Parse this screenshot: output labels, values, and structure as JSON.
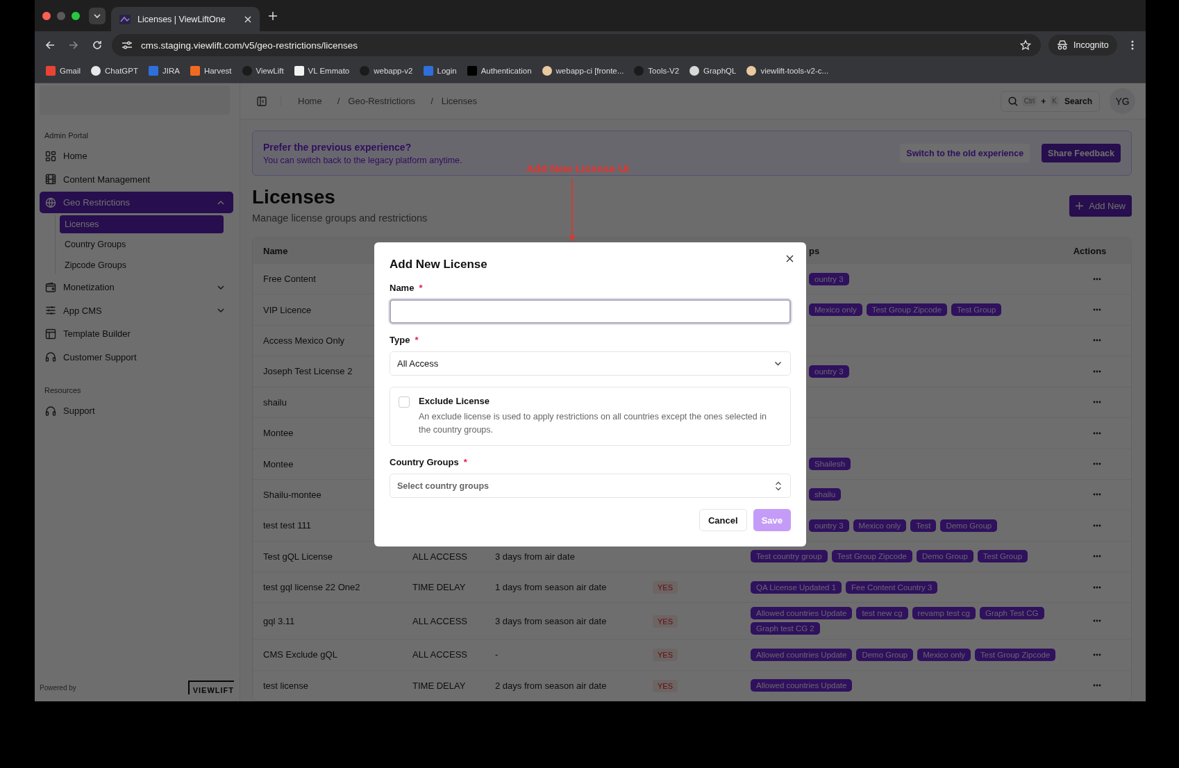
{
  "browser": {
    "tab_title": "Licenses | ViewLiftOne",
    "url": "cms.staging.viewlift.com/v5/geo-restrictions/licenses",
    "profile": "Incognito",
    "bookmarks": [
      {
        "label": "Gmail",
        "kind": "mail"
      },
      {
        "label": "ChatGPT",
        "kind": "knot"
      },
      {
        "label": "JIRA",
        "kind": "blue"
      },
      {
        "label": "Harvest",
        "kind": "orange"
      },
      {
        "label": "ViewLift",
        "kind": "octo"
      },
      {
        "label": "VL Emmato",
        "kind": "white"
      },
      {
        "label": "webapp-v2",
        "kind": "octo"
      },
      {
        "label": "Login",
        "kind": "blue"
      },
      {
        "label": "Authentication",
        "kind": "black"
      },
      {
        "label": "webapp-ci [fronte...",
        "kind": "face"
      },
      {
        "label": "Tools-V2",
        "kind": "octo"
      },
      {
        "label": "GraphQL",
        "kind": "globe"
      },
      {
        "label": "viewlift-tools-v2-c...",
        "kind": "face"
      }
    ]
  },
  "sidebar": {
    "heading": "Admin Portal",
    "items": [
      {
        "label": "Home",
        "selected": false
      },
      {
        "label": "Content Management",
        "selected": false
      },
      {
        "label": "Geo Restrictions",
        "selected": true,
        "expanded": true,
        "children": [
          {
            "label": "Licenses",
            "selected": true
          },
          {
            "label": "Country Groups",
            "selected": false
          },
          {
            "label": "Zipcode Groups",
            "selected": false
          }
        ]
      },
      {
        "label": "Monetization",
        "selected": false,
        "expanded": false
      },
      {
        "label": "App CMS",
        "selected": false,
        "expanded": false
      },
      {
        "label": "Template Builder",
        "selected": false
      },
      {
        "label": "Customer Support",
        "selected": false
      }
    ],
    "resources_heading": "Resources",
    "resources": [
      {
        "label": "Support",
        "selected": false
      }
    ],
    "powered_by": "Powered by",
    "logo": "VIEWLIFT"
  },
  "topbar": {
    "breadcrumbs": [
      {
        "label": "Home"
      },
      {
        "separator": "/",
        "label": "Geo-Restrictions"
      },
      {
        "separator": "/",
        "label": "Licenses"
      }
    ],
    "search": {
      "keys": [
        {
          "text": "Ctrl",
          "kind": "key"
        },
        {
          "text": "+",
          "kind": "plus"
        },
        {
          "text": "K",
          "kind": "key"
        }
      ],
      "label": "Search"
    },
    "avatar": "YG"
  },
  "banner": {
    "title": "Prefer the previous experience?",
    "text": "You can switch back to the legacy platform anytime.",
    "buttons": [
      {
        "label": "Switch to the old experience",
        "kind": "secondary"
      },
      {
        "label": "Share Feedback",
        "kind": "primary"
      }
    ]
  },
  "page": {
    "title": "Licenses",
    "subtitle": "Manage license groups and restrictions",
    "add_button": "Add New"
  },
  "table": {
    "columns": {
      "name": "Name",
      "groups": "ps",
      "actions": "Actions"
    },
    "rows": [
      {
        "name": "Free Content",
        "groups": [
          "ountry 3"
        ]
      },
      {
        "name": "VIP Licence",
        "groups": [
          "Mexico only",
          "Test Group Zipcode",
          "Test Group"
        ]
      },
      {
        "name": "Access Mexico Only"
      },
      {
        "name": "Joseph Test License 2",
        "groups": [
          "ountry 3"
        ]
      },
      {
        "name": "shailu"
      },
      {
        "name": "Montee"
      },
      {
        "name": "Montee",
        "groups": [
          "Shailesh"
        ]
      },
      {
        "name": "Shailu-montee",
        "groups": [
          "shailu"
        ]
      },
      {
        "name": "test test 111",
        "groups": [
          "ountry 3",
          "Mexico only",
          "Test",
          "Demo Group"
        ]
      },
      {
        "name": "Test gQL License",
        "type": "ALL ACCESS",
        "delay": "3 days from air date",
        "groups": [
          "Test country group",
          "Test Group Zipcode",
          "Demo Group",
          "Test Group"
        ]
      },
      {
        "name": "test gql license 22 One2",
        "type": "TIME DELAY",
        "delay": "1 days from season air date",
        "flag": "YES",
        "groups": [
          "QA License Updated 1",
          "Fee Content Country 3"
        ]
      },
      {
        "name": "gql 3.11",
        "type": "ALL ACCESS",
        "delay": "3 days from season air date",
        "flag": "YES",
        "groups": [
          "Allowed countries Update",
          "test new cg",
          "revamp test cg",
          "Graph Test CG",
          "Graph test CG 2"
        ]
      },
      {
        "name": "CMS Exclude gQL",
        "type": "ALL ACCESS",
        "delay": "-",
        "flag": "YES",
        "groups": [
          "Allowed countries Update",
          "Demo Group",
          "Mexico only",
          "Test Group Zipcode"
        ]
      },
      {
        "name": "test license",
        "type": "TIME DELAY",
        "delay": "2 days from season air date",
        "flag": "YES",
        "groups": [
          "Allowed countries Update"
        ]
      }
    ]
  },
  "annotation": "Add New License UI",
  "dialog": {
    "title": "Add New License",
    "name_field": {
      "label": "Name",
      "required_mark": "*",
      "focused": true
    },
    "type_field": {
      "label": "Type",
      "required_mark": "*",
      "value": "All Access"
    },
    "exclude": {
      "label": "Exclude License",
      "checked": false,
      "description": "An exclude license is used to apply restrictions on all countries except the ones selected in the country groups."
    },
    "groups_field": {
      "label": "Country Groups",
      "required_mark": "*",
      "placeholder": "Select country groups"
    },
    "buttons": [
      {
        "label": "Cancel",
        "kind": "secondary",
        "disabled": false
      },
      {
        "label": "Save",
        "kind": "primary",
        "disabled": true
      }
    ]
  }
}
